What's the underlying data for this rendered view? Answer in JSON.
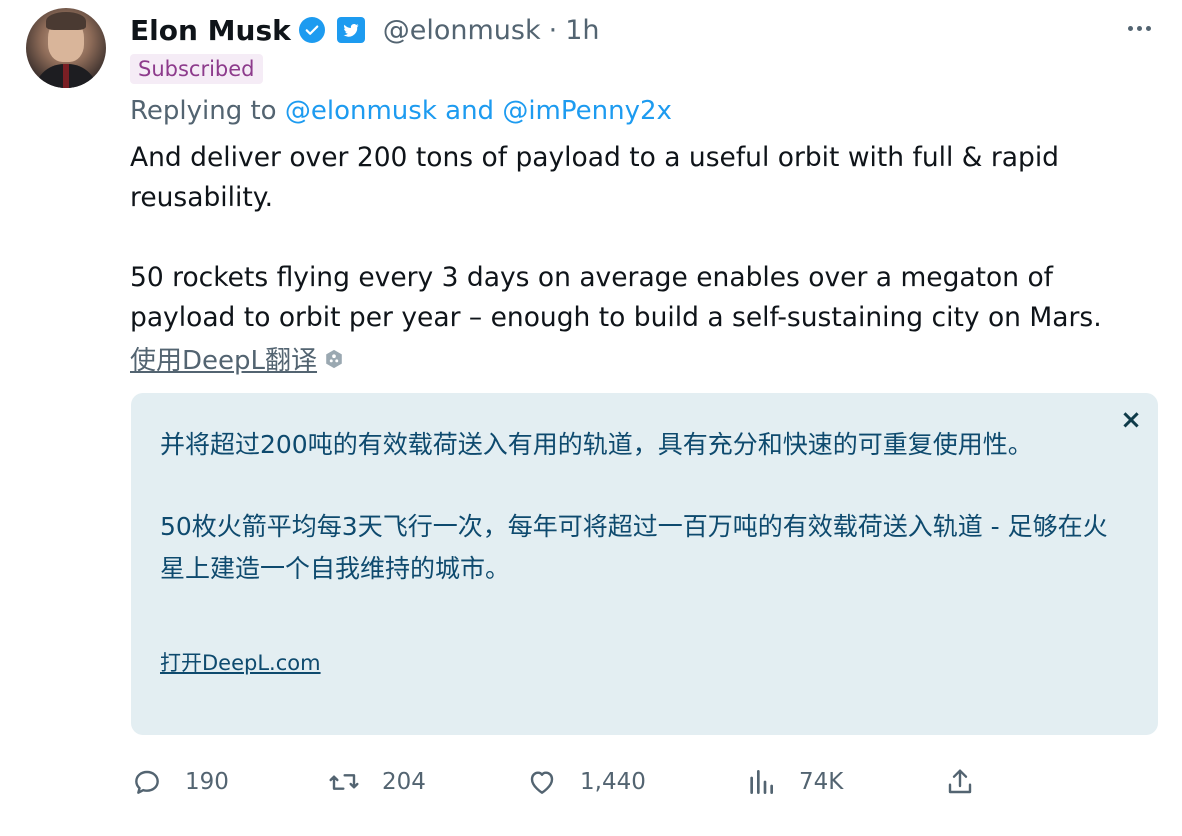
{
  "author": {
    "name": "Elon Musk",
    "handle": "@elonmusk",
    "separator": "·",
    "time": "1h",
    "badge": "Subscribed"
  },
  "reply": {
    "prefix": "Replying to",
    "to1": "@elonmusk",
    "joiner": "and",
    "to2": "@imPenny2x"
  },
  "tweet": {
    "para1": "And deliver over 200 tons of payload to a useful orbit with full & rapid reusability.",
    "para2": "50 rockets flying every 3 days on average enables over a megaton of payload to orbit per year – enough to build a self-sustaining city on Mars."
  },
  "translate_link": "使用DeepL翻译",
  "translation": {
    "close": "×",
    "para1": "并将超过200吨的有效载荷送入有用的轨道，具有充分和快速的可重复使用性。",
    "para2": "50枚火箭平均每3天飞行一次，每年可将超过一百万吨的有效载荷送入轨道 - 足够在火星上建造一个自我维持的城市。",
    "open": "打开DeepL.com"
  },
  "actions": {
    "replies": "190",
    "retweets": "204",
    "likes": "1,440",
    "views": "74K"
  },
  "colors": {
    "accent": "#1d9bf0",
    "muted": "#536471",
    "subscribed_bg": "#f5ecf6",
    "subscribed_fg": "#8d3b8c",
    "translation_bg": "#e3eef2",
    "translation_fg": "#0e4a6e"
  },
  "icons": [
    "verified-badge-icon",
    "twitter-logo-icon",
    "more-icon",
    "deepl-icon",
    "close-icon",
    "reply-icon",
    "retweet-icon",
    "like-icon",
    "views-icon",
    "share-icon"
  ]
}
